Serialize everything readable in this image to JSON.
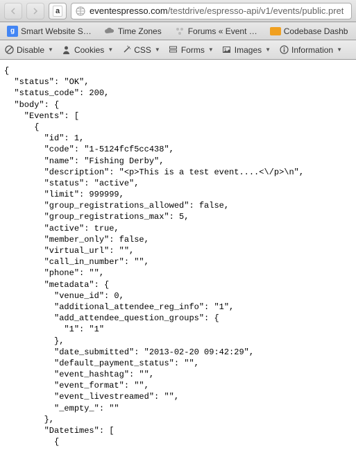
{
  "toolbar": {
    "url_host": "eventespresso.com",
    "url_path": "/testdrive/espresso-api/v1/events/public.pret"
  },
  "bookmarks": [
    {
      "label": "Smart Website S…"
    },
    {
      "label": "Time Zones"
    },
    {
      "label": "Forums « Event …"
    },
    {
      "label": "Codebase Dashb"
    }
  ],
  "devtools": {
    "disable": "Disable",
    "cookies": "Cookies",
    "css": "CSS",
    "forms": "Forms",
    "images": "Images",
    "information": "Information"
  },
  "json_body": "{\n  \"status\": \"OK\",\n  \"status_code\": 200,\n  \"body\": {\n    \"Events\": [\n      {\n        \"id\": 1,\n        \"code\": \"1-5124fcf5cc438\",\n        \"name\": \"Fishing Derby\",\n        \"description\": \"<p>This is a test event....<\\/p>\\n\",\n        \"status\": \"active\",\n        \"limit\": 999999,\n        \"group_registrations_allowed\": false,\n        \"group_registrations_max\": 5,\n        \"active\": true,\n        \"member_only\": false,\n        \"virtual_url\": \"\",\n        \"call_in_number\": \"\",\n        \"phone\": \"\",\n        \"metadata\": {\n          \"venue_id\": 0,\n          \"additional_attendee_reg_info\": \"1\",\n          \"add_attendee_question_groups\": {\n            \"1\": \"1\"\n          },\n          \"date_submitted\": \"2013-02-20 09:42:29\",\n          \"default_payment_status\": \"\",\n          \"event_hashtag\": \"\",\n          \"event_format\": \"\",\n          \"event_livestreamed\": \"\",\n          \"_empty_\": \"\"\n        },\n        \"Datetimes\": [\n          {"
}
